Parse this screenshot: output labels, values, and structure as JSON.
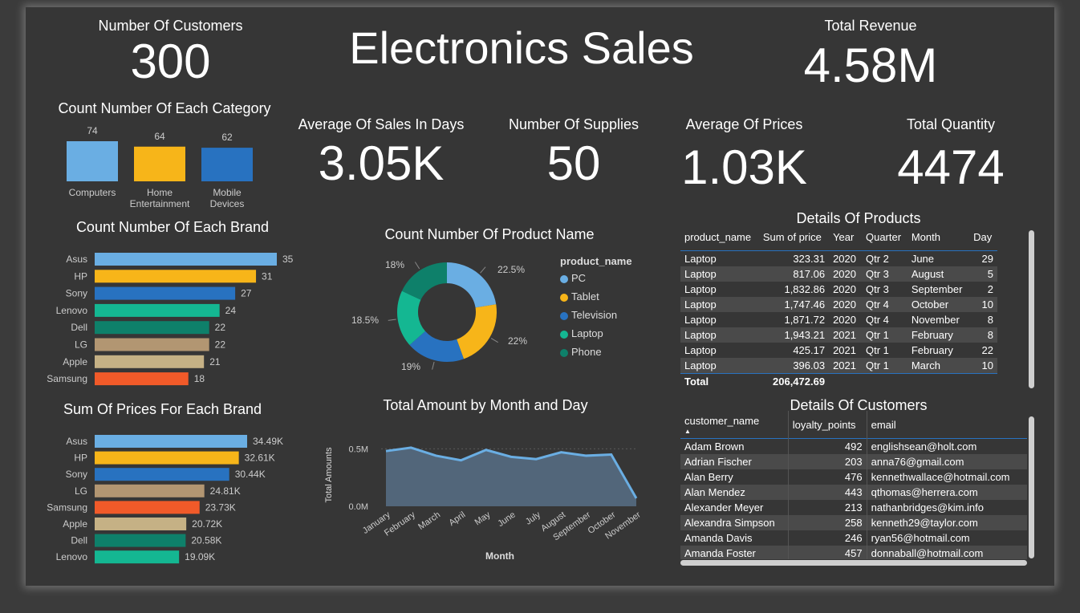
{
  "title": "Electronics Sales",
  "kpis": {
    "customers": {
      "label": "Number Of Customers",
      "value": "300"
    },
    "revenue": {
      "label": "Total Revenue",
      "value": "4.58M"
    },
    "avg_sales_days": {
      "label": "Average Of Sales In Days",
      "value": "3.05K"
    },
    "supplies": {
      "label": "Number Of Supplies",
      "value": "50"
    },
    "avg_prices": {
      "label": "Average Of Prices",
      "value": "1.03K"
    },
    "total_qty": {
      "label": "Total Quantity",
      "value": "4474"
    }
  },
  "colors": {
    "blue_light": "#6aaee3",
    "yellow": "#f7b519",
    "blue": "#2872c0",
    "teal": "#14b792",
    "dark_teal": "#0e806a",
    "tan": "#b29672",
    "khaki": "#c5b185",
    "orange": "#f15a29",
    "area_line": "#6aaee3",
    "area_fill": "#52667a"
  },
  "chart_data": [
    {
      "id": "category",
      "type": "bar",
      "title": "Count Number Of Each Category",
      "categories": [
        "Computers",
        "Home Entertainment",
        "Mobile Devices"
      ],
      "category_lines": [
        [
          "Computers"
        ],
        [
          "Home",
          "Entertainment"
        ],
        [
          "Mobile",
          "Devices"
        ]
      ],
      "values": [
        74,
        64,
        62
      ],
      "colors": [
        "#6aaee3",
        "#f7b519",
        "#2872c0"
      ]
    },
    {
      "id": "brand_count",
      "type": "bar",
      "orientation": "horizontal",
      "title": "Count Number Of Each Brand",
      "categories": [
        "Asus",
        "HP",
        "Sony",
        "Lenovo",
        "Dell",
        "LG",
        "Apple",
        "Samsung"
      ],
      "values": [
        35,
        31,
        27,
        24,
        22,
        22,
        21,
        18
      ],
      "labels": [
        "35",
        "31",
        "27",
        "24",
        "22",
        "22",
        "21",
        "18"
      ],
      "colors": [
        "#6aaee3",
        "#f7b519",
        "#2872c0",
        "#14b792",
        "#0e806a",
        "#b29672",
        "#c5b185",
        "#f15a29"
      ]
    },
    {
      "id": "brand_prices",
      "type": "bar",
      "orientation": "horizontal",
      "title": "Sum Of Prices For Each Brand",
      "categories": [
        "Asus",
        "HP",
        "Sony",
        "LG",
        "Samsung",
        "Apple",
        "Dell",
        "Lenovo"
      ],
      "values": [
        34490,
        32610,
        30440,
        24810,
        23730,
        20720,
        20580,
        19090
      ],
      "labels": [
        "34.49K",
        "32.61K",
        "30.44K",
        "24.81K",
        "23.73K",
        "20.72K",
        "20.58K",
        "19.09K"
      ],
      "colors": [
        "#6aaee3",
        "#f7b519",
        "#2872c0",
        "#b29672",
        "#f15a29",
        "#c5b185",
        "#0e806a",
        "#14b792"
      ]
    },
    {
      "id": "product_name",
      "type": "pie",
      "title": "Count Number Of Product Name",
      "legend_title": "product_name",
      "categories": [
        "PC",
        "Tablet",
        "Television",
        "Laptop",
        "Phone"
      ],
      "values": [
        22.5,
        22,
        19,
        18.5,
        18
      ],
      "labels": [
        "22.5%",
        "22%",
        "19%",
        "18.5%",
        "18%"
      ],
      "colors": [
        "#6aaee3",
        "#f7b519",
        "#2872c0",
        "#14b792",
        "#0e806a"
      ]
    },
    {
      "id": "amount_month",
      "type": "area",
      "title": "Total Amount by Month and Day",
      "xlabel": "Month",
      "ylabel": "Total Amounts",
      "x": [
        "January",
        "February",
        "March",
        "April",
        "May",
        "June",
        "July",
        "August",
        "September",
        "October",
        "November"
      ],
      "values": [
        480000,
        510000,
        440000,
        400000,
        490000,
        430000,
        410000,
        470000,
        440000,
        450000,
        70000
      ],
      "yticks": [
        "0.0M",
        "0.5M"
      ],
      "ylim": [
        0,
        600000
      ]
    }
  ],
  "products": {
    "title": "Details Of Products",
    "columns": [
      "product_name",
      "Sum of price",
      "Year",
      "Quarter",
      "Month",
      "Day"
    ],
    "rows": [
      [
        "Laptop",
        "323.31",
        "2020",
        "Qtr 2",
        "June",
        "29"
      ],
      [
        "Laptop",
        "817.06",
        "2020",
        "Qtr 3",
        "August",
        "5"
      ],
      [
        "Laptop",
        "1,832.86",
        "2020",
        "Qtr 3",
        "September",
        "2"
      ],
      [
        "Laptop",
        "1,747.46",
        "2020",
        "Qtr 4",
        "October",
        "10"
      ],
      [
        "Laptop",
        "1,871.72",
        "2020",
        "Qtr 4",
        "November",
        "8"
      ],
      [
        "Laptop",
        "1,943.21",
        "2021",
        "Qtr 1",
        "February",
        "8"
      ],
      [
        "Laptop",
        "425.17",
        "2021",
        "Qtr 1",
        "February",
        "22"
      ],
      [
        "Laptop",
        "396.03",
        "2021",
        "Qtr 1",
        "March",
        "10"
      ]
    ],
    "total_label": "Total",
    "total_value": "206,472.69"
  },
  "customers": {
    "title": "Details Of Customers",
    "columns": [
      "customer_name",
      "loyalty_points",
      "email"
    ],
    "rows": [
      [
        "Adam Brown",
        "492",
        "englishsean@holt.com"
      ],
      [
        "Adrian Fischer",
        "203",
        "anna76@gmail.com"
      ],
      [
        "Alan Berry",
        "476",
        "kennethwallace@hotmail.com"
      ],
      [
        "Alan Mendez",
        "443",
        "qthomas@herrera.com"
      ],
      [
        "Alexander Meyer",
        "213",
        "nathanbridges@kim.info"
      ],
      [
        "Alexandra Simpson",
        "258",
        "kenneth29@taylor.com"
      ],
      [
        "Amanda Davis",
        "246",
        "ryan56@hotmail.com"
      ],
      [
        "Amanda Foster",
        "457",
        "donnaball@hotmail.com"
      ]
    ]
  }
}
